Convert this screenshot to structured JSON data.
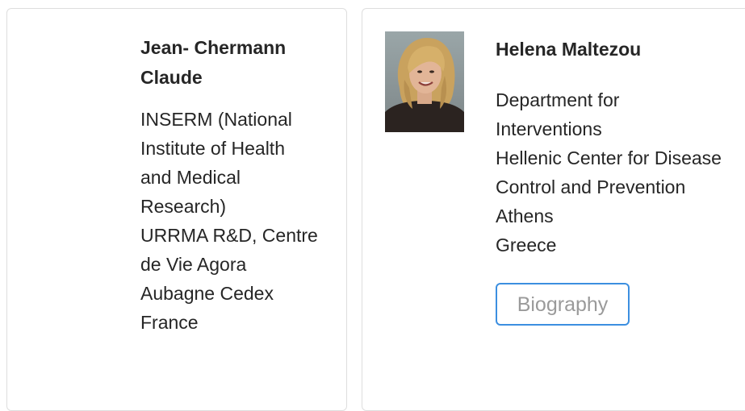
{
  "profiles": [
    {
      "name": "Jean-Claude Chermann",
      "name_lines": [
        "Jean- Chermann",
        "Claude"
      ],
      "address_lines": [
        "INSERM (National",
        "Institute of Health",
        "and Medical",
        "Research)",
        "URRMA R&D, Centre",
        "de Vie Agora",
        "Aubagne Cedex",
        "France"
      ]
    },
    {
      "name": "Helena Maltezou",
      "has_photo": true,
      "address_lines": [
        "Department for",
        "Interventions",
        "Hellenic Center for Disease",
        "Control and Prevention",
        "Athens",
        "Greece"
      ],
      "button_label": "Biography",
      "button_border_color": "#3c8fe0"
    }
  ]
}
